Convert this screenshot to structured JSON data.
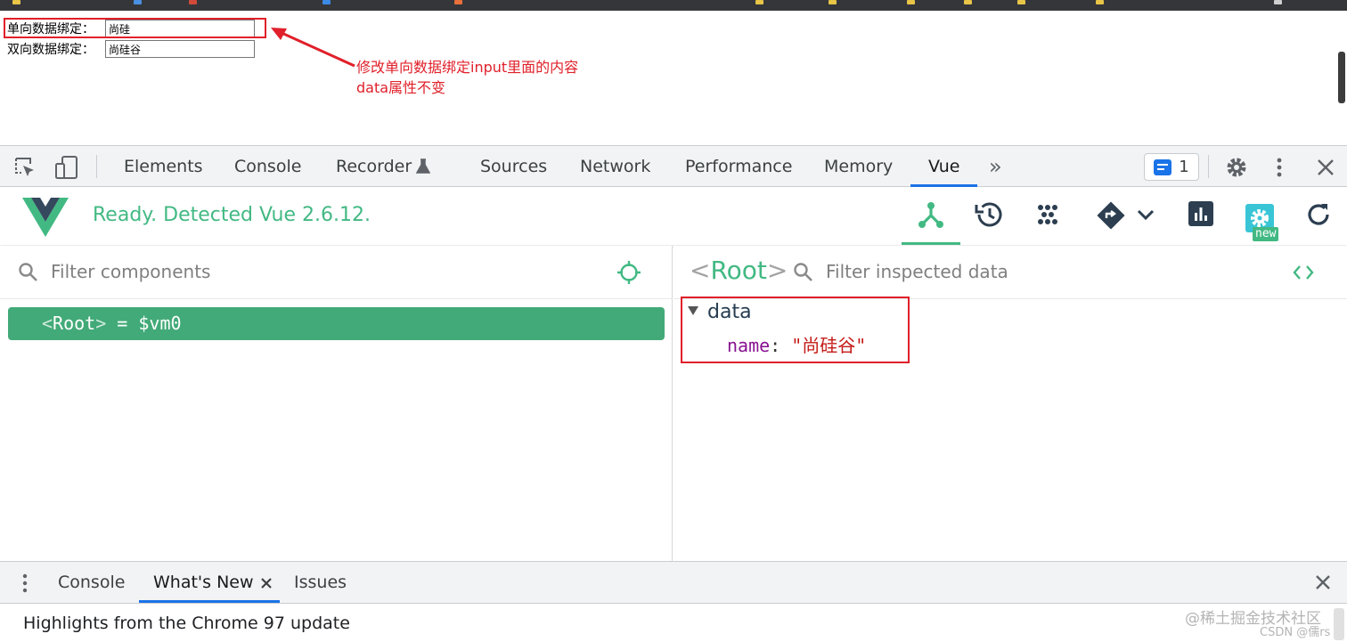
{
  "page": {
    "one_way_label": "单向数据绑定：",
    "one_way_value": "尚硅",
    "two_way_label": "双向数据绑定：",
    "two_way_value": "尚硅谷",
    "annotation_line1": "修改单向数据绑定input里面的内容",
    "annotation_line2": "data属性不变"
  },
  "devtools": {
    "tabs": [
      "Elements",
      "Console",
      "Recorder",
      "Sources",
      "Network",
      "Performance",
      "Memory",
      "Vue"
    ],
    "active_tab": "Vue",
    "message_count": "1",
    "icons": [
      "inspect-icon",
      "device-toolbar-icon",
      "flask-icon",
      "more-tabs-icon",
      "message-icon",
      "gear-icon",
      "kebab-menu-icon",
      "close-icon"
    ]
  },
  "vue": {
    "status": "Ready. Detected Vue 2.6.12.",
    "new_badge": "new",
    "toolbar_icons": [
      "components-tree-icon",
      "history-icon",
      "vuex-dots-icon",
      "router-icon",
      "chevron-down-icon",
      "performance-chart-icon",
      "settings-gear-icon",
      "refresh-icon"
    ],
    "filter_components_placeholder": "Filter components",
    "root_component": "Root",
    "root_suffix": " = $vm0",
    "inspected_title": "Root",
    "filter_data_placeholder": "Filter inspected data",
    "data_section": "data",
    "data_key": "name",
    "data_value": "\"尚硅谷\"",
    "accent_color": "#42b983"
  },
  "drawer": {
    "tabs": [
      "Console",
      "What's New",
      "Issues"
    ],
    "active_tab": "What's New",
    "content": "Highlights from the Chrome 97 update"
  },
  "watermark": {
    "line1": "@稀土掘金技术社区",
    "line2": "CSDN @儒rs"
  },
  "colors": {
    "annotation_red": "#e0202a",
    "devtools_blue": "#1a73e8",
    "vue_green": "#42b983"
  }
}
